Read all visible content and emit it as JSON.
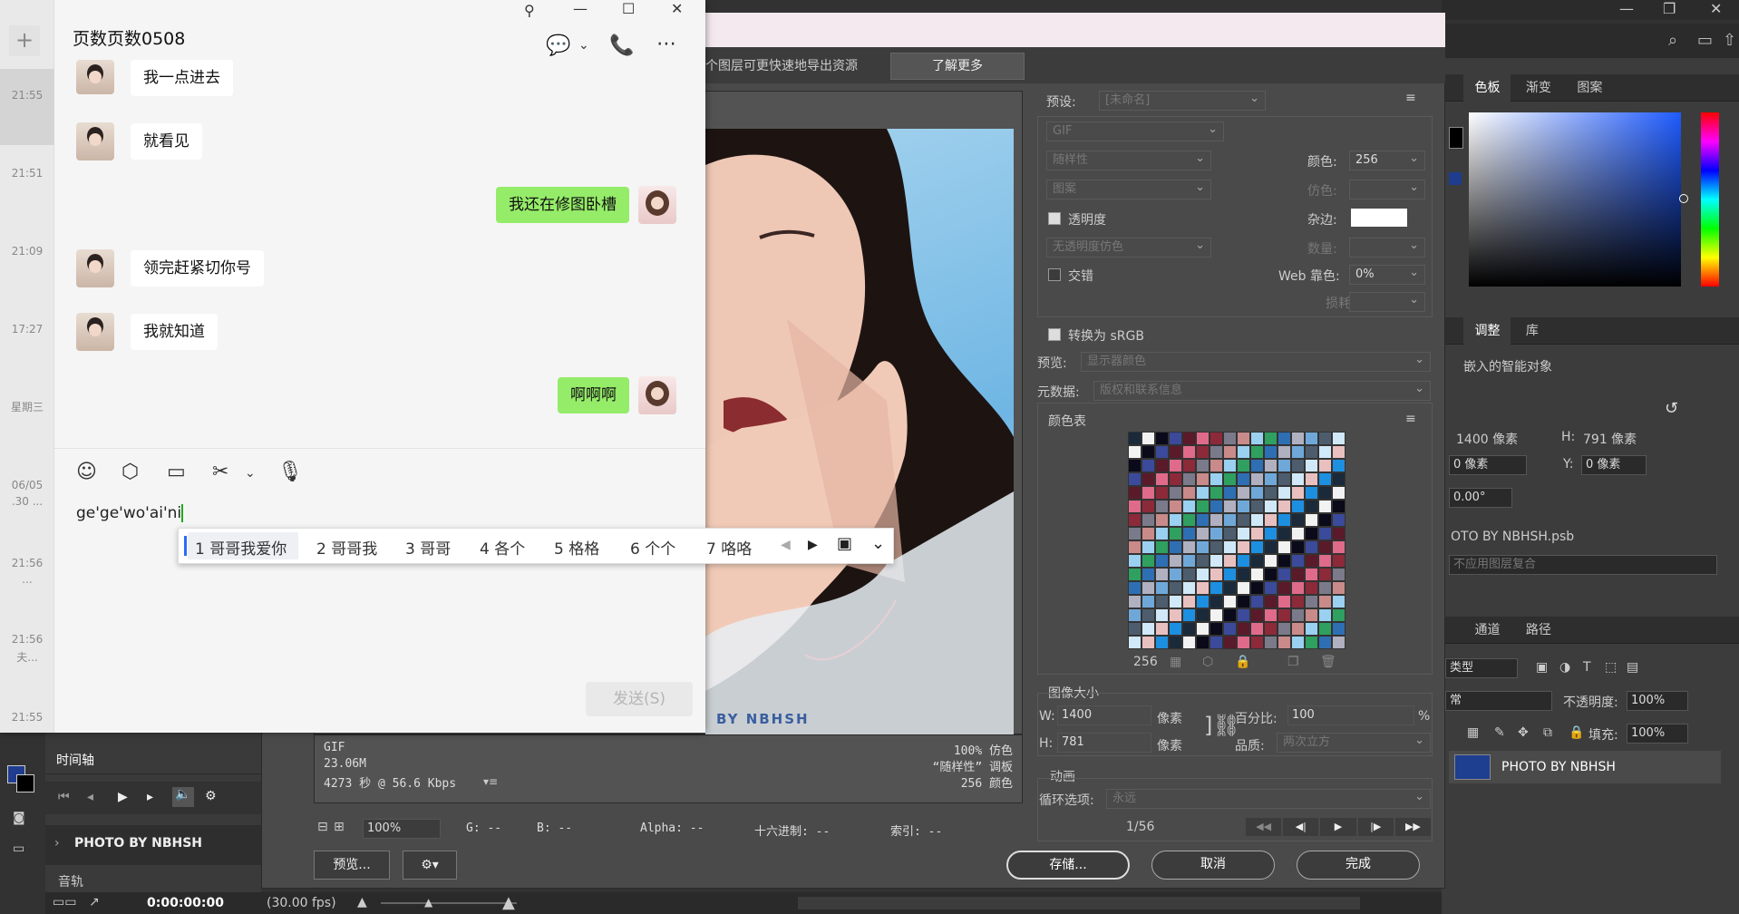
{
  "wechat": {
    "title": "页数页数0508",
    "sidebar_items": [
      {
        "time": "21:55",
        "preview": ""
      },
      {
        "time": "21:51",
        "preview": ""
      },
      {
        "time": "21:09",
        "preview": ""
      },
      {
        "time": "17:27",
        "preview": ""
      },
      {
        "time": "星期三",
        "preview": ""
      },
      {
        "time": "06/05",
        "preview": ".30 ..."
      },
      {
        "time": "21:56",
        "preview": "..."
      },
      {
        "time": "21:56",
        "preview": "夫..."
      },
      {
        "time": "21:55",
        "preview": ""
      }
    ],
    "messages": [
      {
        "from": "other",
        "text": "我一点进去"
      },
      {
        "from": "other",
        "text": "就看见"
      },
      {
        "from": "me",
        "text": "我还在修图卧槽"
      },
      {
        "from": "other",
        "text": "领完赶紧切你号"
      },
      {
        "from": "other",
        "text": "我就知道"
      },
      {
        "from": "me",
        "text": "啊啊啊"
      }
    ],
    "input_text": "ge'ge'wo'ai'ni",
    "send_label": "发送(S)",
    "ime_candidates": [
      "1 哥哥我爱你",
      "2 哥哥我",
      "3 哥哥",
      "4 各个",
      "5 格格",
      "6 个个",
      "7 咯咯"
    ]
  },
  "sfw": {
    "info_text": "个图层可更快速地导出资源",
    "learn_more": "了解更多",
    "preset_label": "预设:",
    "preset_value": "[未命名]",
    "format": "GIF",
    "reduction": "随样性",
    "dither_algo": "图案",
    "colors_label": "颜色:",
    "colors_value": "256",
    "dither_label": "仿色:",
    "transparency_label": "透明度",
    "matte_label": "杂边:",
    "no_transparency_dither": "无透明度仿色",
    "amount_label": "数量:",
    "interlaced_label": "交错",
    "websnap_label": "Web 靠色:",
    "websnap_value": "0%",
    "lossy_label": "损耗:",
    "convert_srgb": "转换为 sRGB",
    "preview_label": "预览:",
    "preview_value": "显示器颜色",
    "metadata_label": "元数据:",
    "metadata_value": "版权和联系信息",
    "color_table_label": "颜色表",
    "color_count": "256",
    "image_size_label": "图像大小",
    "w_label": "W:",
    "w_value": "1400",
    "h_label": "H:",
    "h_value": "781",
    "px_unit": "像素",
    "percent_label": "百分比:",
    "percent_value": "100",
    "percent_sign": "%",
    "quality_label": "品质:",
    "quality_value": "两次立方",
    "animation_label": "动画",
    "loop_label": "循环选项:",
    "loop_value": "永远",
    "frame_counter": "1/56",
    "watermark": "BY NBHSH",
    "info_left": [
      "GIF",
      "23.06M",
      "4273 秒 @ 56.6 Kbps"
    ],
    "info_right": [
      "100% 仿色",
      "“随样性” 调板",
      "256 颜色"
    ],
    "zoom_value": "100%",
    "g_label": "G: --",
    "b_label": "B: --",
    "alpha_label": "Alpha: --",
    "hex_label": "十六进制: --",
    "index_label": "索引: --",
    "preview_btn": "预览...",
    "save_btn": "存储...",
    "cancel_btn": "取消",
    "done_btn": "完成"
  },
  "ps": {
    "color_tabs": [
      "色板",
      "渐变",
      "图案"
    ],
    "adjust_tabs": [
      "调整",
      "库"
    ],
    "smart_object": "嵌入的智能对象",
    "w_px": "1400 像素",
    "h_label": "H:",
    "h_px": "791 像素",
    "x_val": "0 像素",
    "y_label": "Y:",
    "y_val": "0 像素",
    "angle": "0.00°",
    "psb_name": "OTO BY NBHSH.psb",
    "comp_placeholder": "不应用图层复合",
    "layers_tabs": [
      "通道",
      "路径"
    ],
    "kind_label": "类型",
    "blend_mode": "常",
    "opacity_label": "不透明度:",
    "opacity_value": "100%",
    "fill_label": "填充:",
    "fill_value": "100%",
    "layer_name": "PHOTO BY NBHSH",
    "timeline_title": "时间轴",
    "track_name": "PHOTO BY NBHSH",
    "audio_label": "音轨",
    "timecode": "0:00:00:00",
    "fps": "(30.00 fps)"
  }
}
